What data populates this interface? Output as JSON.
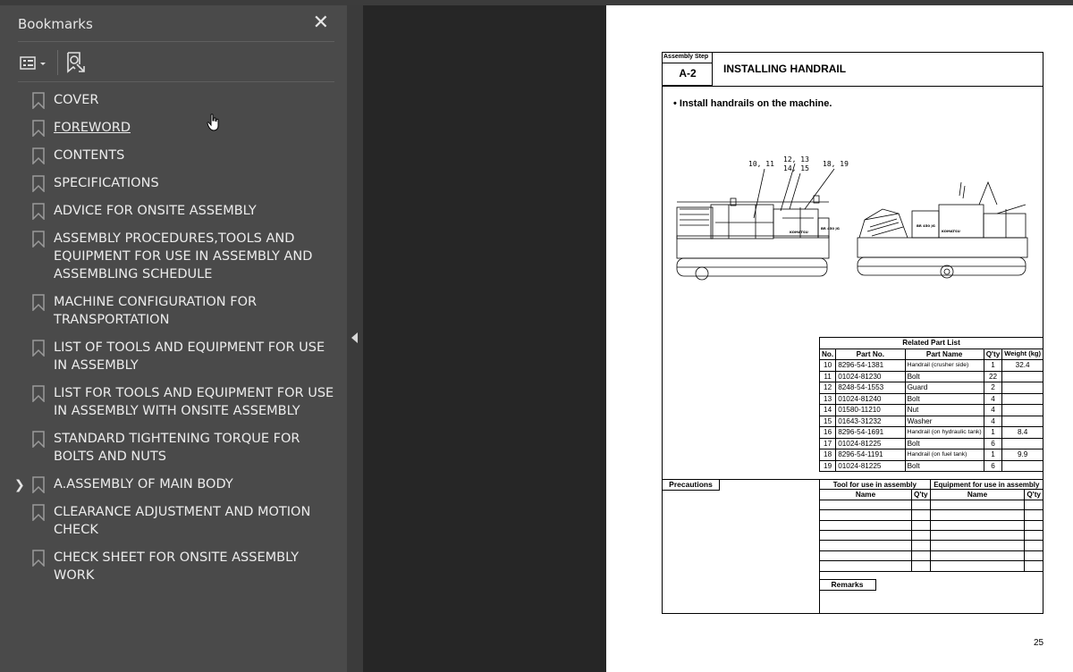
{
  "sidebar": {
    "title": "Bookmarks",
    "close_icon": "close-icon",
    "options_icon": "list-options-icon",
    "find_icon": "find-bookmark-icon",
    "items": [
      {
        "label": "COVER",
        "expandable": false
      },
      {
        "label": "FOREWORD",
        "expandable": false,
        "underlined": true
      },
      {
        "label": "CONTENTS",
        "expandable": false
      },
      {
        "label": "SPECIFICATIONS",
        "expandable": false
      },
      {
        "label": "ADVICE FOR ONSITE ASSEMBLY",
        "expandable": false
      },
      {
        "label": "ASSEMBLY PROCEDURES,TOOLS AND EQUIPMENT FOR USE IN ASSEMBLY AND ASSEMBLING SCHEDULE",
        "expandable": false
      },
      {
        "label": "MACHINE CONFIGURATION FOR TRANSPORTATION",
        "expandable": false
      },
      {
        "label": "LIST OF TOOLS AND EQUIPMENT FOR USE IN ASSEMBLY",
        "expandable": false
      },
      {
        "label": "LIST FOR TOOLS AND EQUIPMENT FOR USE IN ASSEMBLY WITH ONSITE ASSEMBLY",
        "expandable": false
      },
      {
        "label": "STANDARD TIGHTENING TORQUE FOR BOLTS AND NUTS",
        "expandable": false
      },
      {
        "label": "A.ASSEMBLY OF MAIN BODY",
        "expandable": true
      },
      {
        "label": "CLEARANCE ADJUSTMENT AND MOTION CHECK",
        "expandable": false
      },
      {
        "label": "CHECK SHEET FOR ONSITE ASSEMBLY WORK",
        "expandable": false
      }
    ]
  },
  "document": {
    "assembly_step_label": "Assembly Step",
    "step_number": "A-2",
    "title": "INSTALLING HANDRAIL",
    "instruction": "• Install handrails on the machine.",
    "figure_callouts": [
      "10, 11",
      "12, 13",
      "14, 15",
      "18, 19"
    ],
    "figure_labels": [
      "KOMATSU",
      "BR 450 JG",
      "BR 450 JG",
      "KOMATSU"
    ],
    "related_parts_title": "Related Part List",
    "parts_headers": [
      "No.",
      "Part No.",
      "Part Name",
      "Q'ty",
      "Weight (kg)"
    ],
    "parts": [
      {
        "no": "10",
        "part_no": "8296-54-1381",
        "name": "Handrail (crusher side)",
        "qty": "1",
        "weight": "32.4"
      },
      {
        "no": "11",
        "part_no": "01024-81230",
        "name": "Bolt",
        "qty": "22",
        "weight": ""
      },
      {
        "no": "12",
        "part_no": "8248-54-1553",
        "name": "Guard",
        "qty": "2",
        "weight": ""
      },
      {
        "no": "13",
        "part_no": "01024-81240",
        "name": "Bolt",
        "qty": "4",
        "weight": ""
      },
      {
        "no": "14",
        "part_no": "01580-11210",
        "name": "Nut",
        "qty": "4",
        "weight": ""
      },
      {
        "no": "15",
        "part_no": "01643-31232",
        "name": "Washer",
        "qty": "4",
        "weight": ""
      },
      {
        "no": "16",
        "part_no": "8296-54-1691",
        "name": "Handrail (on hydraulic tank)",
        "qty": "1",
        "weight": "8.4"
      },
      {
        "no": "17",
        "part_no": "01024-81225",
        "name": "Bolt",
        "qty": "6",
        "weight": ""
      },
      {
        "no": "18",
        "part_no": "8296-54-1191",
        "name": "Handrail (on fuel tank)",
        "qty": "1",
        "weight": "9.9"
      },
      {
        "no": "19",
        "part_no": "01024-81225",
        "name": "Bolt",
        "qty": "6",
        "weight": ""
      }
    ],
    "precautions_label": "Precautions",
    "tool_header": "Tool for use in assembly",
    "equipment_header": "Equipment for use in assembly",
    "name_header": "Name",
    "qty_header": "Q'ty",
    "remarks_label": "Remarks",
    "page_number": "25"
  }
}
